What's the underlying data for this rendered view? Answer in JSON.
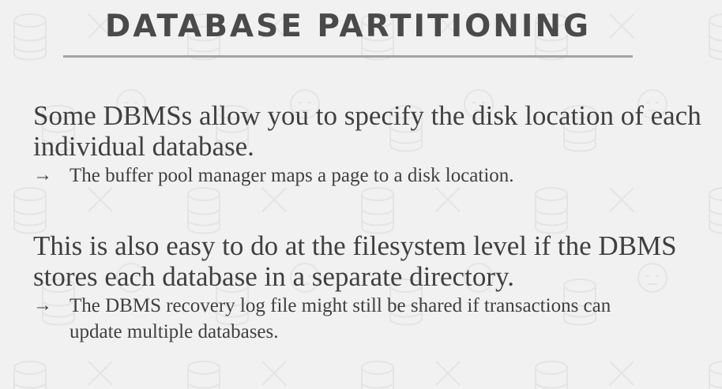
{
  "slide": {
    "title": "DATABASE PARTITIONING",
    "blocks": [
      {
        "main": "Some DBMSs allow you to specify the disk location of each individual database.",
        "bullet_icon": "→",
        "sub": "The buffer pool manager maps a page to a disk location."
      },
      {
        "main": "This is also easy to do at the filesystem level if the DBMS stores each database in a separate directory.",
        "bullet_icon": "→",
        "sub": "The DBMS recovery log file might still be shared if transactions can update multiple databases."
      }
    ]
  },
  "colors": {
    "background": "#f1f1f1",
    "title": "#4a4a4a",
    "rule": "#a3a3a3",
    "text": "#404040"
  }
}
